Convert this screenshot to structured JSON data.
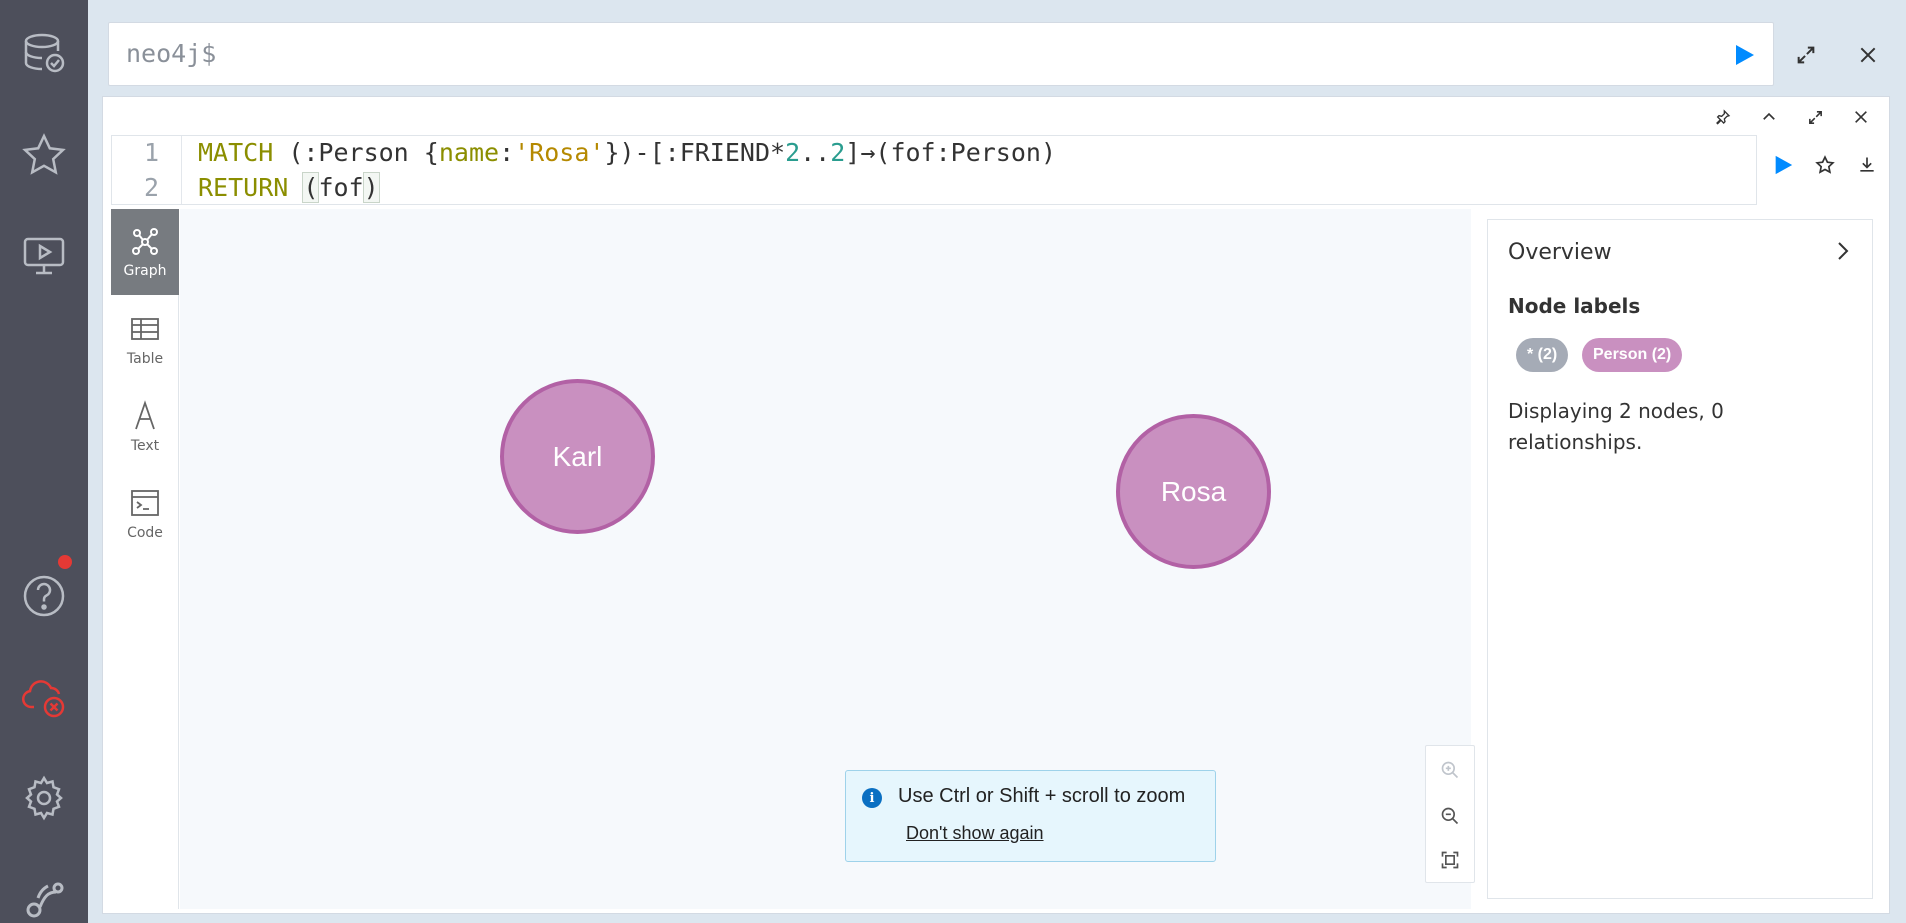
{
  "command_bar": {
    "placeholder": "neo4j$"
  },
  "editor": {
    "line_numbers": [
      "1",
      "2"
    ],
    "line1": {
      "kw": "MATCH",
      "p1": " (:Person {",
      "prop": "name",
      "colon": ":",
      "str": "'Rosa'",
      "p2": "})-[:FRIEND*",
      "n1": "2",
      "dots": "..",
      "n2": "2",
      "p3": "]→(fof:Person)"
    },
    "line2": {
      "kw": "RETURN",
      "open": "(",
      "var": "fof",
      "close": ")"
    }
  },
  "views": [
    {
      "label": "Graph",
      "active": true
    },
    {
      "label": "Table",
      "active": false
    },
    {
      "label": "Text",
      "active": false
    },
    {
      "label": "Code",
      "active": false
    }
  ],
  "graph": {
    "nodes": [
      {
        "caption": "Karl",
        "color": "#c990c0",
        "border": "#b261a5"
      },
      {
        "caption": "Rosa",
        "color": "#c990c0",
        "border": "#b261a5"
      }
    ]
  },
  "toast": {
    "message": "Use Ctrl or Shift + scroll to zoom",
    "dismiss": "Don't show again"
  },
  "overview": {
    "title": "Overview",
    "node_labels_heading": "Node labels",
    "labels": [
      {
        "text": "* (2)",
        "color": "#a5abb6"
      },
      {
        "text": "Person (2)",
        "color": "#c990c0"
      }
    ],
    "summary": "Displaying 2 nodes, 0 relationships."
  },
  "colors": {
    "sidebar": "#4d4f5b",
    "run_button": "#018bff",
    "error_icon": "#e53935"
  }
}
